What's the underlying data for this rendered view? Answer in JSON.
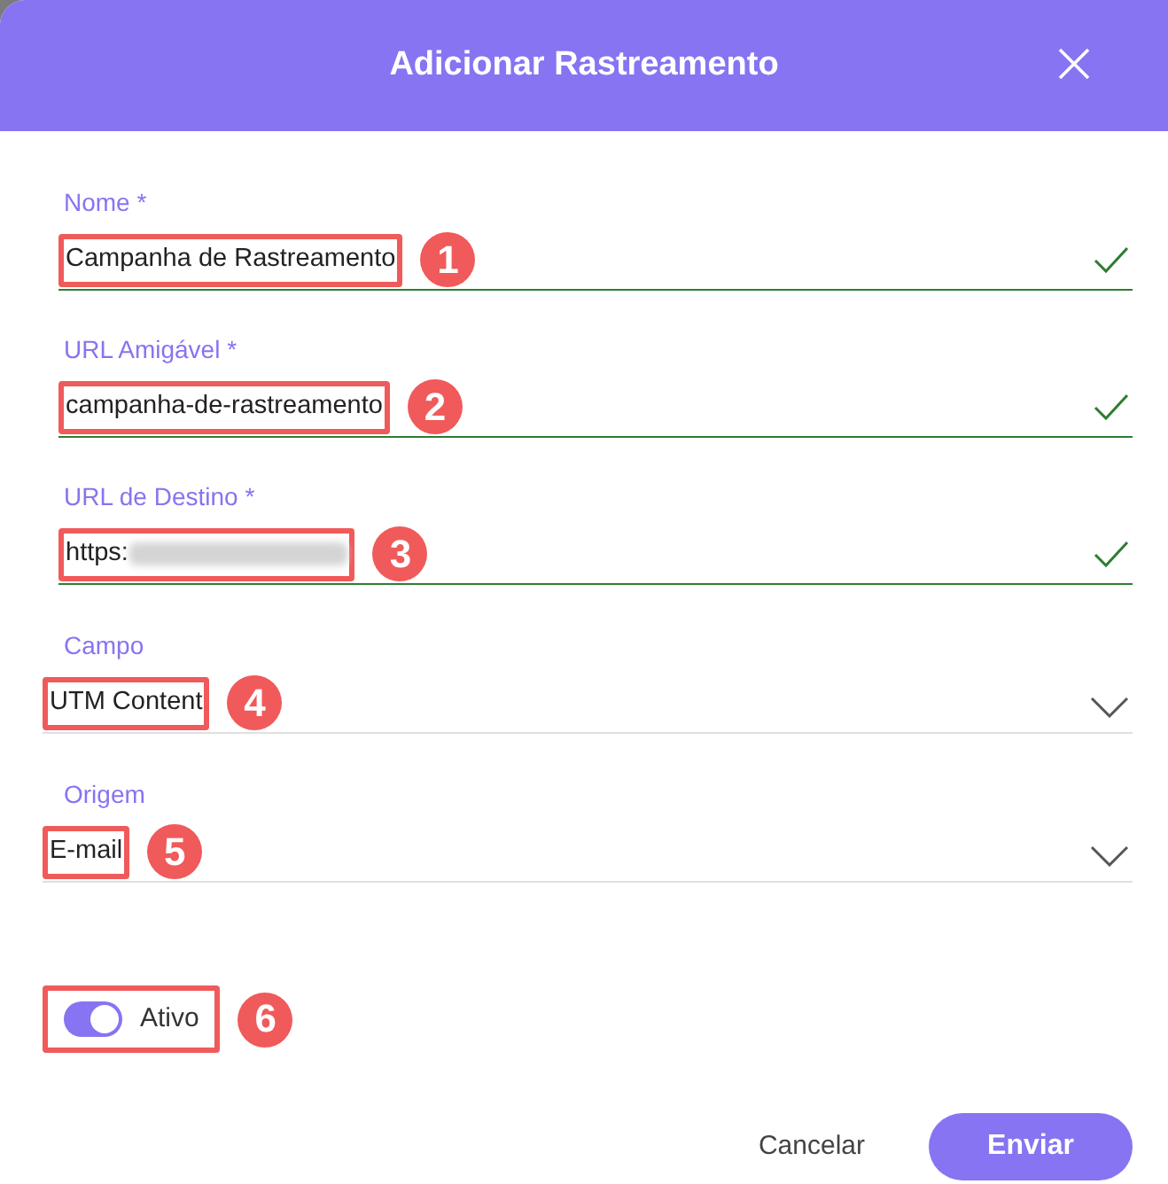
{
  "dialog": {
    "title": "Adicionar Rastreamento"
  },
  "fields": [
    {
      "kind": "text",
      "label": "Nome *",
      "value": "Campanha de Rastreamento",
      "valid": true,
      "callout": "1"
    },
    {
      "kind": "text",
      "label": "URL Amigável *",
      "value": "campanha-de-rastreamento",
      "valid": true,
      "callout": "2"
    },
    {
      "kind": "text",
      "label": "URL de Destino *",
      "value": "https:",
      "blurred": true,
      "valid": true,
      "callout": "3"
    },
    {
      "kind": "select",
      "label": "Campo",
      "value": "UTM Content",
      "callout": "4"
    },
    {
      "kind": "select",
      "label": "Origem",
      "value": "E-mail",
      "callout": "5"
    }
  ],
  "toggle": {
    "label": "Ativo",
    "on": true,
    "callout": "6"
  },
  "buttons": {
    "cancel": "Cancelar",
    "submit": "Enviar"
  }
}
